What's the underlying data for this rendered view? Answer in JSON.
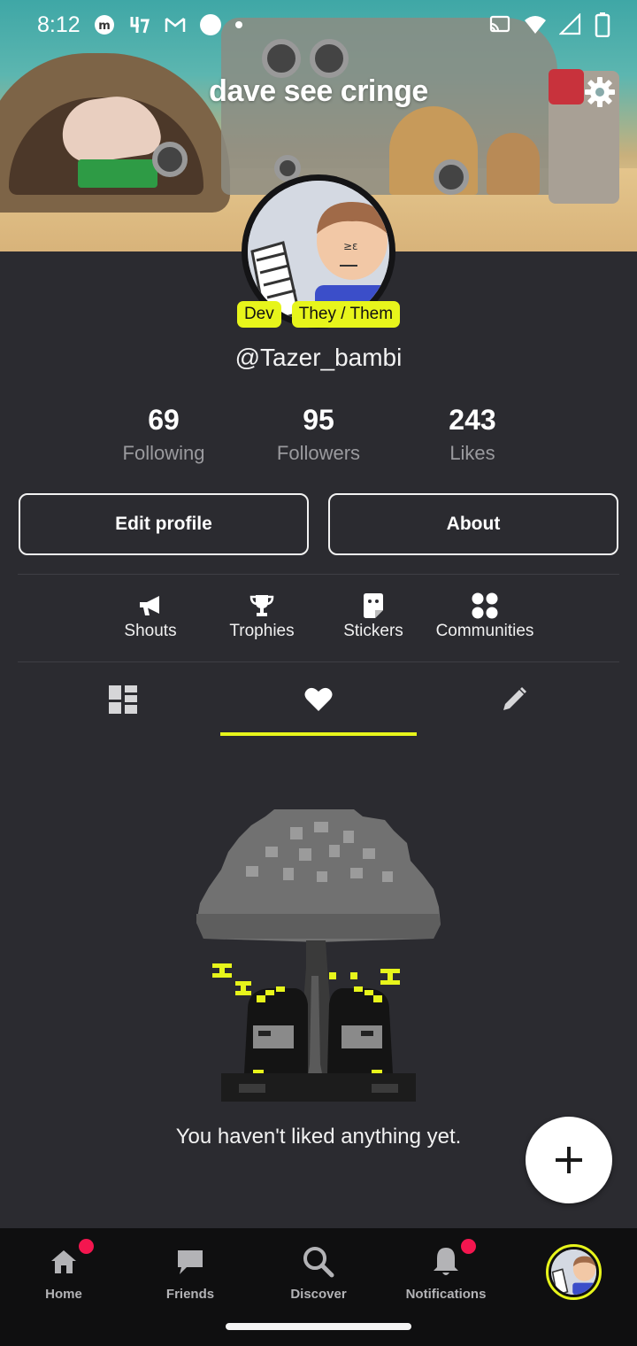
{
  "status_bar": {
    "time": "8:12"
  },
  "profile": {
    "title": "dave see cringe",
    "tags": [
      "Dev",
      "They / Them"
    ],
    "handle": "@Tazer_bambi"
  },
  "stats": [
    {
      "value": "69",
      "label": "Following"
    },
    {
      "value": "95",
      "label": "Followers"
    },
    {
      "value": "243",
      "label": "Likes"
    }
  ],
  "buttons": {
    "edit": "Edit profile",
    "about": "About"
  },
  "quick_links": [
    "Shouts",
    "Trophies",
    "Stickers",
    "Communities"
  ],
  "tabs": {
    "selected": "likes"
  },
  "empty_state": {
    "message": "You haven't liked anything yet."
  },
  "bottom_nav": [
    "Home",
    "Friends",
    "Discover",
    "Notifications"
  ],
  "colors": {
    "accent": "#e7f51b",
    "background": "#2b2b30",
    "badge": "#f4164f"
  }
}
